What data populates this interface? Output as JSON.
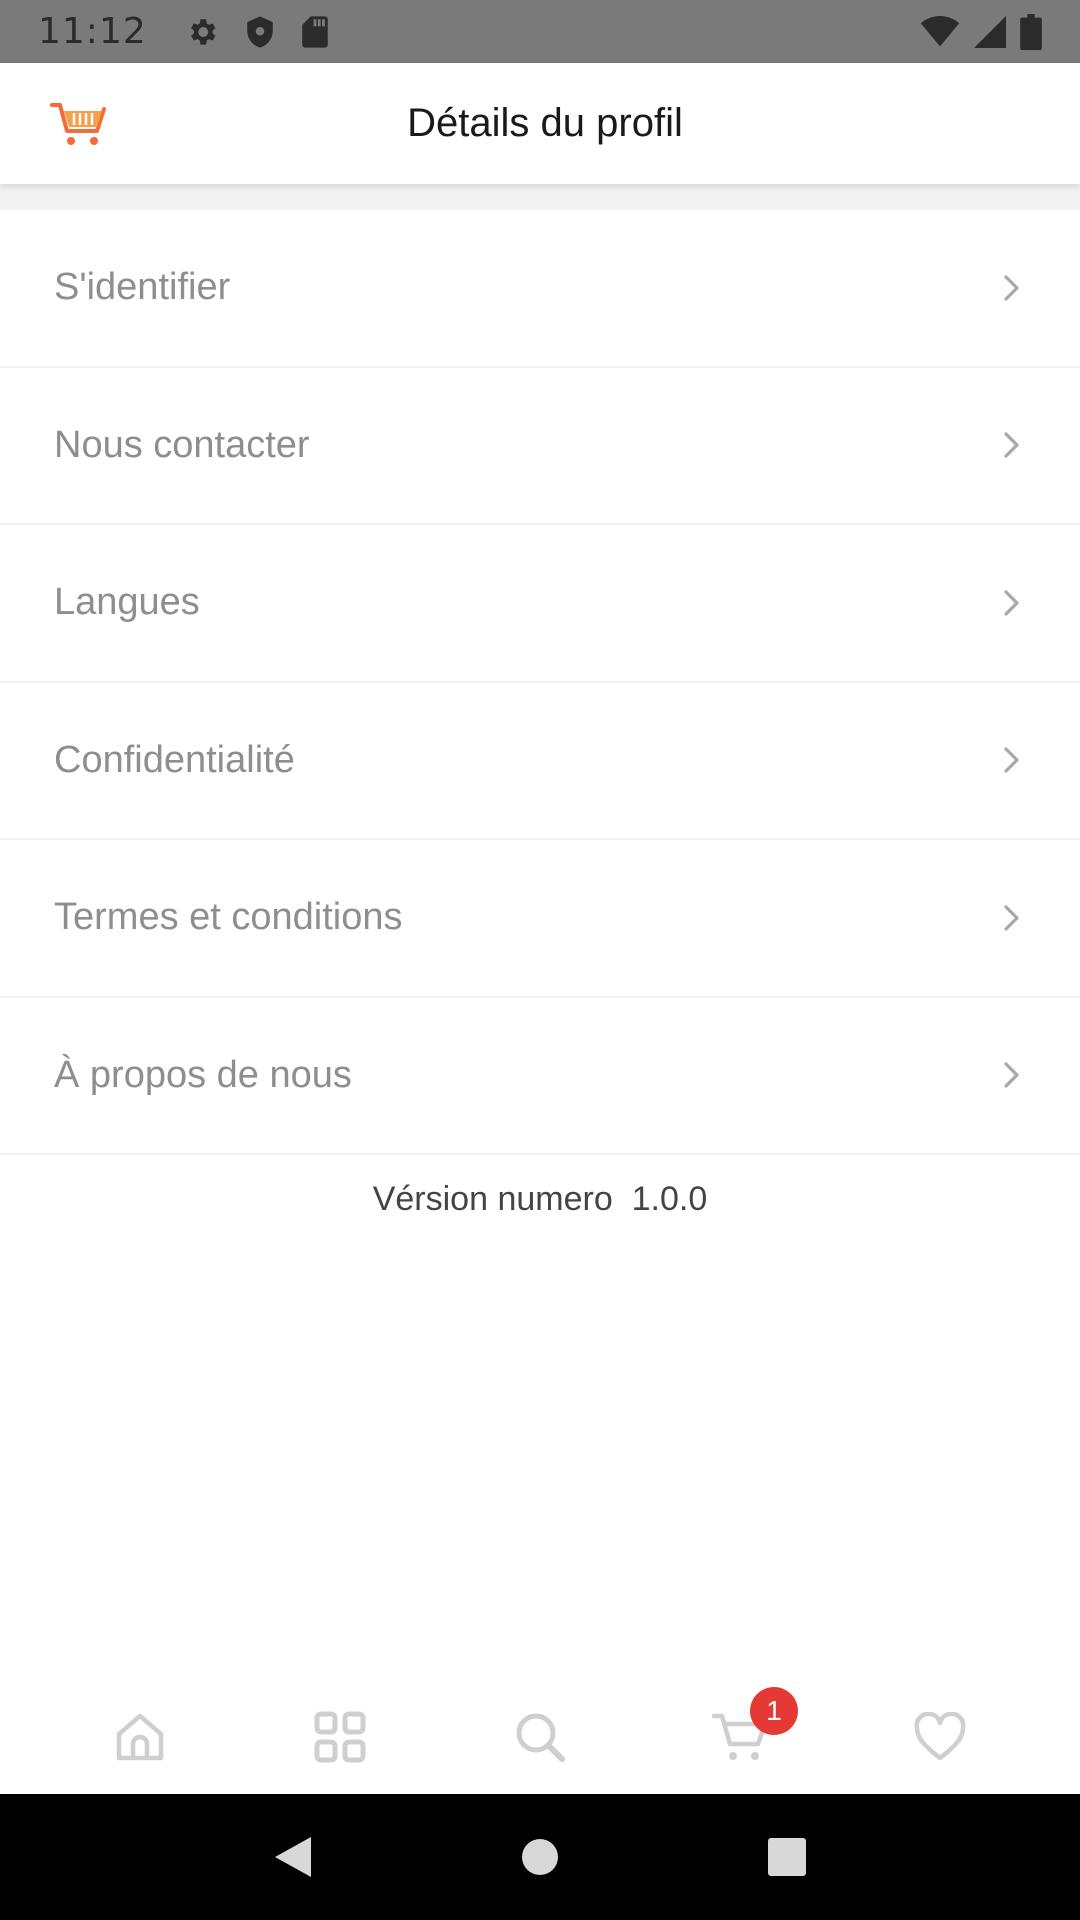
{
  "status_bar": {
    "time": "11:12",
    "left_icons": [
      "gear-icon",
      "shield-icon",
      "sd-card-icon"
    ],
    "right_icons": [
      "wifi-icon",
      "signal-icon",
      "battery-icon"
    ]
  },
  "app_bar": {
    "logo": "shopping-cart-logo",
    "title": "Détails du profil"
  },
  "menu": {
    "items": [
      {
        "label": "S'identifier"
      },
      {
        "label": "Nous contacter"
      },
      {
        "label": "Langues"
      },
      {
        "label": "Confidentialité"
      },
      {
        "label": "Termes et conditions"
      },
      {
        "label": "À propos de nous"
      }
    ]
  },
  "version": {
    "label": "Vérsion numero",
    "number": "1.0.0"
  },
  "bottom_nav": {
    "items": [
      "home-icon",
      "grid-icon",
      "search-icon",
      "cart-icon",
      "heart-icon"
    ],
    "cart_badge": "1"
  },
  "colors": {
    "accent": "#f26b3a",
    "badge": "#e53935",
    "icon_gray": "#cfcfcf",
    "menu_text": "#8e8e8e"
  }
}
